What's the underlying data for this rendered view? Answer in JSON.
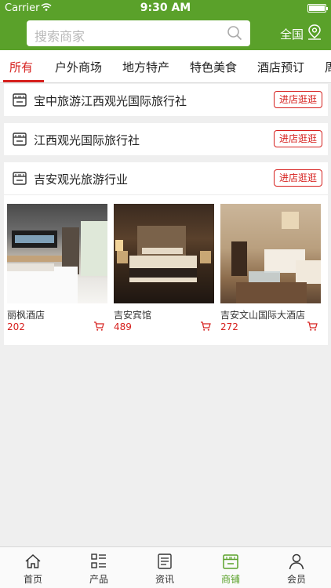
{
  "status": {
    "carrier": "Carrier",
    "time": "9:30 AM"
  },
  "header": {
    "search_placeholder": "搜索商家",
    "region": "全国",
    "brand_color": "#5aa12a"
  },
  "tabs": [
    {
      "label": "所有",
      "active": true
    },
    {
      "label": "户外商场"
    },
    {
      "label": "地方特产"
    },
    {
      "label": "特色美食"
    },
    {
      "label": "酒店预订"
    },
    {
      "label": "周"
    }
  ],
  "stores": [
    {
      "name": "宝中旅游江西观光国际旅行社",
      "button": "进店逛逛"
    },
    {
      "name": "江西观光国际旅行社",
      "button": "进店逛逛"
    },
    {
      "name": "吉安观光旅游行业",
      "button": "进店逛逛"
    }
  ],
  "products": [
    {
      "name": "丽枫酒店",
      "price": "202"
    },
    {
      "name": "吉安宾馆",
      "price": "489"
    },
    {
      "name": "吉安文山国际大酒店",
      "price": "272"
    }
  ],
  "tabbar": [
    {
      "label": "首页",
      "icon": "home-icon"
    },
    {
      "label": "产品",
      "icon": "list-icon"
    },
    {
      "label": "资讯",
      "icon": "news-icon"
    },
    {
      "label": "商铺",
      "icon": "store-icon",
      "active": true
    },
    {
      "label": "会员",
      "icon": "user-icon"
    }
  ],
  "accent_color": "#d6201e"
}
